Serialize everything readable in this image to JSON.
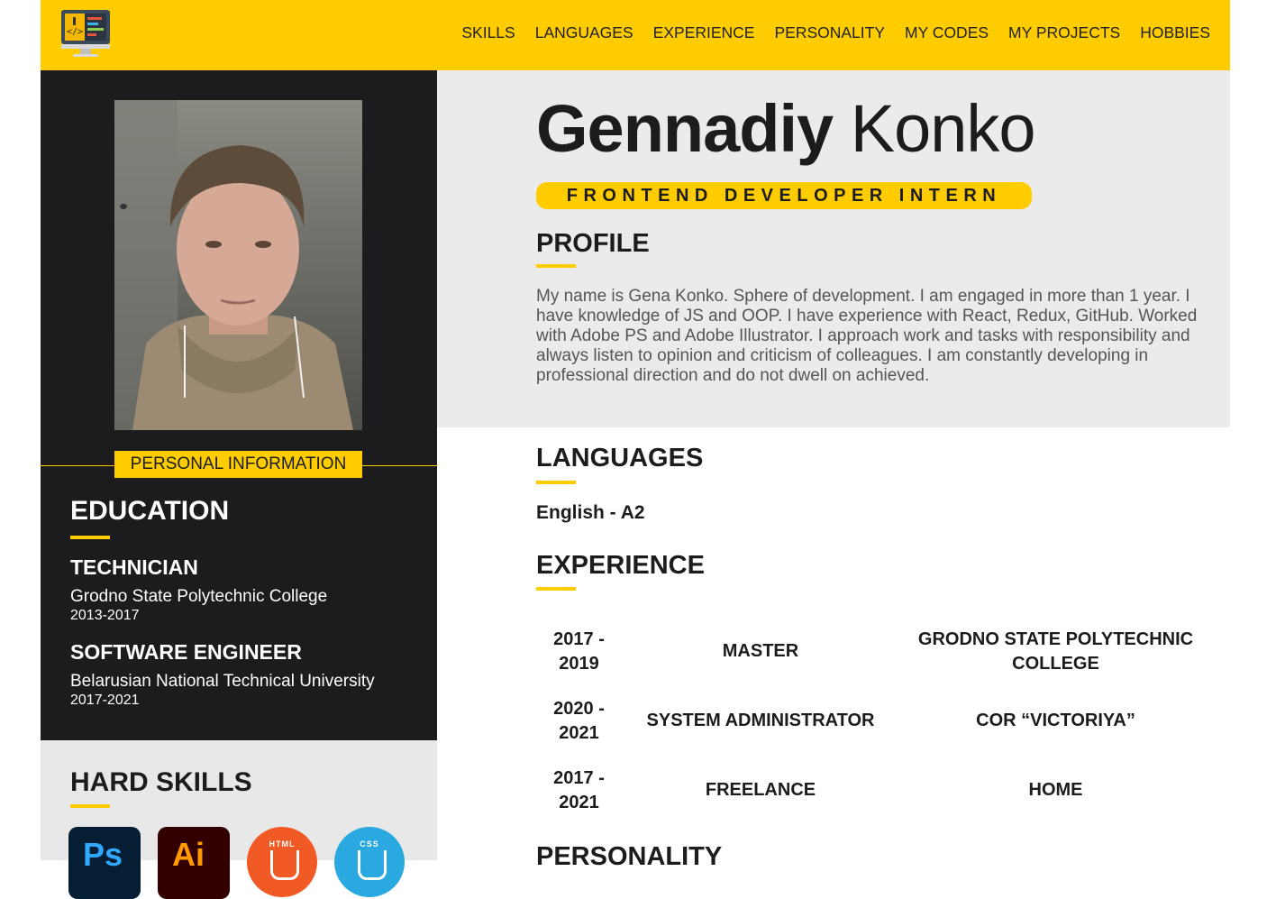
{
  "nav": {
    "items": [
      "SKILLS",
      "LANGUAGES",
      "EXPERIENCE",
      "PERSONALITY",
      "MY CODES",
      "MY PROJECTS",
      "HOBBIES"
    ]
  },
  "colors": {
    "accent": "#ffcc00",
    "dark": "#1c1c1e",
    "light_bg": "#ebebeb"
  },
  "sidebar": {
    "personal_info_label": "PERSONAL INFORMATION",
    "education": {
      "title": "EDUCATION",
      "items": [
        {
          "degree": "TECHNICIAN",
          "school": "Grodno State Polytechnic College",
          "years": "2013-2017"
        },
        {
          "degree": "SOFTWARE ENGINEER",
          "school": "Belarusian National Technical University",
          "years": "2017-2021"
        }
      ]
    },
    "hard_skills": {
      "title": "HARD SKILLS",
      "icons": [
        {
          "name": "photoshop-icon",
          "text": "Ps"
        },
        {
          "name": "illustrator-icon",
          "text": "Ai"
        },
        {
          "name": "html5-icon",
          "text": "HTML"
        },
        {
          "name": "css3-icon",
          "text": "CSS"
        }
      ]
    }
  },
  "hero": {
    "first_name": "Gennadiy",
    "last_name": "Konko",
    "role": "FRONTEND DEVELOPER INTERN"
  },
  "profile": {
    "title": "PROFILE",
    "text": "My name is Gena Konko. Sphere of development. I am engaged in more than 1 year. I have knowledge of JS and OOP. I have experience with React, Redux, GitHub. Worked with Adobe PS and Adobe Illustrator. I approach work and tasks with responsibility and always listen to opinion and criticism of colleagues. I am constantly developing in professional direction and do not dwell on achieved."
  },
  "languages": {
    "title": "LANGUAGES",
    "items": [
      "English - A2"
    ]
  },
  "experience": {
    "title": "EXPERIENCE",
    "rows": [
      {
        "years": "2017 - 2019",
        "role": "MASTER",
        "place": "GRODNO STATE POLYTECHNIC COLLEGE"
      },
      {
        "years": "2020 - 2021",
        "role": "SYSTEM ADMINISTRATOR",
        "place": "COR “VICTORIYA”"
      },
      {
        "years": "2017 - 2021",
        "role": "FREELANCE",
        "place": "HOME"
      }
    ]
  },
  "personality": {
    "title": "PERSONALITY"
  }
}
